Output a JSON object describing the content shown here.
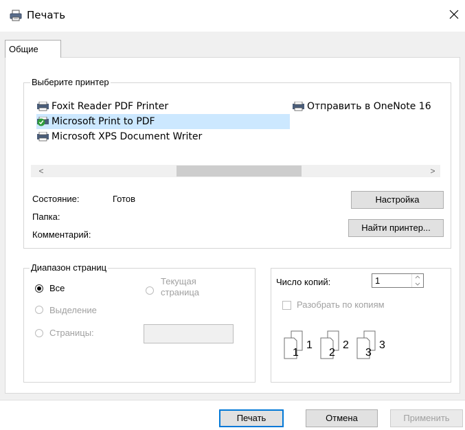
{
  "window": {
    "title": "Печать",
    "icon": "printer-icon",
    "close_icon": "close-icon"
  },
  "tabs": [
    {
      "label": "Общие",
      "active": true
    }
  ],
  "printer_group": {
    "legend": "Выберите принтер",
    "printers": [
      {
        "name": "Foxit Reader PDF Printer",
        "icon": "printer-icon",
        "selected": false
      },
      {
        "name": "Microsoft Print to PDF",
        "icon": "default-printer-icon",
        "selected": true
      },
      {
        "name": "Microsoft XPS Document Writer",
        "icon": "printer-icon",
        "selected": false
      },
      {
        "name": "Отправить в OneNote 16",
        "icon": "printer-icon",
        "selected": false
      }
    ],
    "scroll_left": "<",
    "scroll_right": ">",
    "status_label": "Состояние:",
    "status_value": "Готов",
    "folder_label": "Папка:",
    "comment_label": "Комментарий:",
    "preferences_button": "Настройка",
    "find_printer_button": "Найти принтер..."
  },
  "range_group": {
    "legend": "Диапазон страниц",
    "all": "Все",
    "current_page": "Текущая страница",
    "selection": "Выделение",
    "pages": "Страницы:",
    "selected_option": "all"
  },
  "copies_group": {
    "copies_label": "Число копий:",
    "copies_value": "1",
    "collate_label": "Разобрать по копиям",
    "collate_checked": false,
    "collate_icon_numbers": [
      "1",
      "1",
      "2",
      "2",
      "3",
      "3"
    ]
  },
  "footer": {
    "print_button": "Печать",
    "cancel_button": "Отмена",
    "apply_button": "Применить"
  },
  "colors": {
    "selection": "#cce8ff",
    "dialog_bg": "#f0f0f0",
    "accent": "#0078d7",
    "disabled_text": "#a0a0a0"
  }
}
